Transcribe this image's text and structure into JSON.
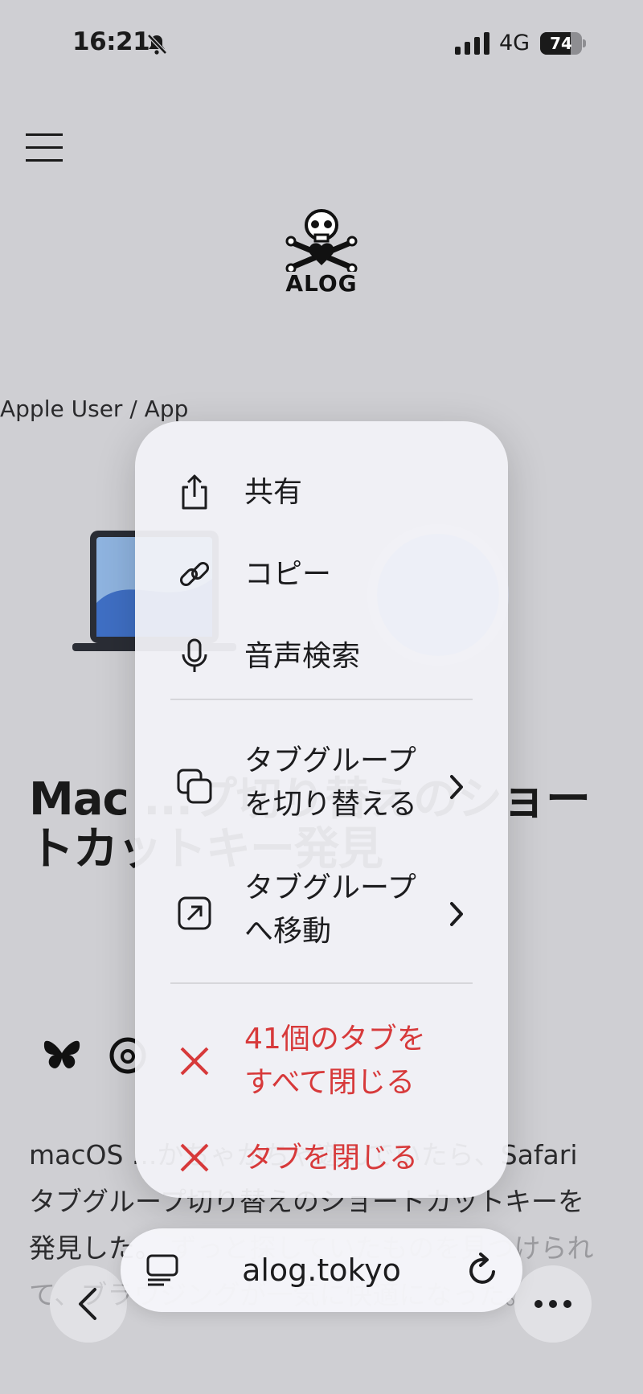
{
  "status_bar": {
    "time": "16:21",
    "network": "4G",
    "battery": "74",
    "battery_level": 0.74
  },
  "page": {
    "breadcrumb": "Apple User / App",
    "logo_text": "ALOG",
    "title": "Mac ...プ切り替えのショートカットキー発見",
    "body": "macOS ...かちゃかちゃ遊んでいたら、Safari タブグループ切り替えのショートカットキーを発見した。",
    "body_fade": "ずっと探していたものを見つけられて、ブラウジングが一気に快適になった。"
  },
  "menu": {
    "items": [
      {
        "label": "共有",
        "icon": "share-icon"
      },
      {
        "label": "コピー",
        "icon": "link-icon"
      },
      {
        "label": "音声検索",
        "icon": "microphone-icon"
      },
      {
        "label_line1": "タブグループ",
        "label_line2": "を切り替える",
        "icon": "tab-group-icon"
      },
      {
        "label_line1": "タブグループ",
        "label_line2": "へ移動",
        "icon": "move-to-icon"
      },
      {
        "label_line1": "41個のタブを",
        "label_line2": "すべて閉じる",
        "icon": "close-icon"
      },
      {
        "label": "タブを閉じる",
        "icon": "close-icon"
      }
    ],
    "destructive_color": "#d7393a"
  },
  "toolbar": {
    "url": "alog.tokyo"
  }
}
